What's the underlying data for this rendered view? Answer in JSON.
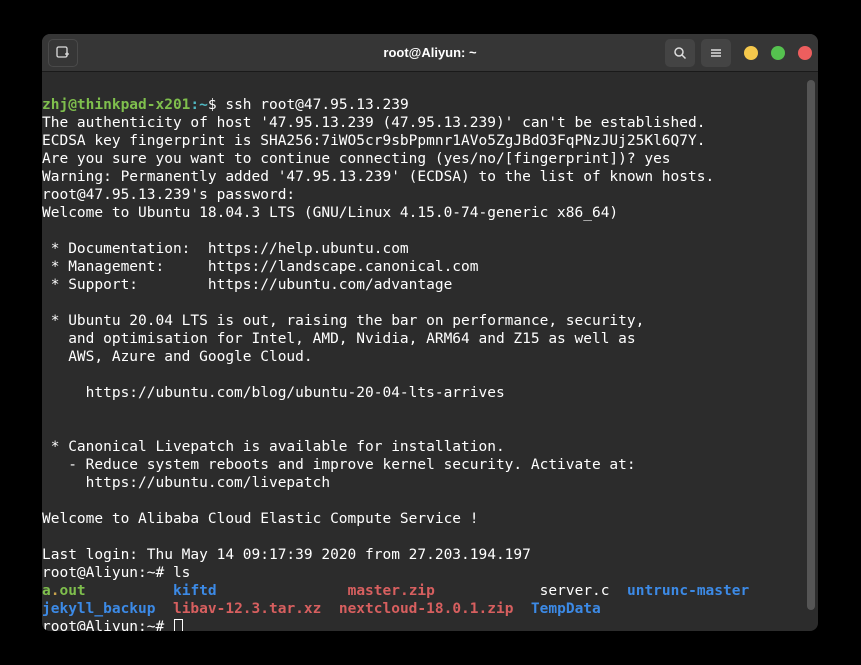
{
  "titlebar": {
    "title": "root@Aliyun: ~"
  },
  "prompt_local": {
    "user_host": "zhj@thinkpad-x201",
    "colon": ":",
    "path": "~",
    "sigil": "$ ",
    "cmd": "ssh root@47.95.13.239"
  },
  "output": {
    "l1": "The authenticity of host '47.95.13.239 (47.95.13.239)' can't be established.",
    "l2": "ECDSA key fingerprint is SHA256:7iWO5cr9sbPpmnr1AVo5ZgJBdO3FqPNzJUj25Kl6Q7Y.",
    "l3": "Are you sure you want to continue connecting (yes/no/[fingerprint])? yes",
    "l4": "Warning: Permanently added '47.95.13.239' (ECDSA) to the list of known hosts.",
    "l5": "root@47.95.13.239's password:",
    "l6": "Welcome to Ubuntu 18.04.3 LTS (GNU/Linux 4.15.0-74-generic x86_64)",
    "l7": "",
    "l8": " * Documentation:  https://help.ubuntu.com",
    "l9": " * Management:     https://landscape.canonical.com",
    "l10": " * Support:        https://ubuntu.com/advantage",
    "l11": "",
    "l12": " * Ubuntu 20.04 LTS is out, raising the bar on performance, security,",
    "l13": "   and optimisation for Intel, AMD, Nvidia, ARM64 and Z15 as well as",
    "l14": "   AWS, Azure and Google Cloud.",
    "l15": "",
    "l16": "     https://ubuntu.com/blog/ubuntu-20-04-lts-arrives",
    "l17": "",
    "l18": "",
    "l19": " * Canonical Livepatch is available for installation.",
    "l20": "   - Reduce system reboots and improve kernel security. Activate at:",
    "l21": "     https://ubuntu.com/livepatch",
    "l22": "",
    "l23": "Welcome to Alibaba Cloud Elastic Compute Service !",
    "l24": "",
    "l25": "Last login: Thu May 14 09:17:39 2020 from 27.203.194.197",
    "p1": "root@Aliyun:~# ",
    "cmd_ls": "ls",
    "p2": "root@Aliyun:~# "
  },
  "listing": {
    "r1c1": "a",
    "r1c1dot": ".",
    "r1c1ext": "out",
    "r1c2": "kiftd",
    "r1c3": "master.zip",
    "r1c4": "server.c",
    "r1c5": "untrunc-master",
    "r2c1": "jekyll_backup",
    "r2c2": "libav-12.3.tar.xz",
    "r2c3": "nextcloud-18.0.1.zip",
    "r2c4": "TempData"
  }
}
